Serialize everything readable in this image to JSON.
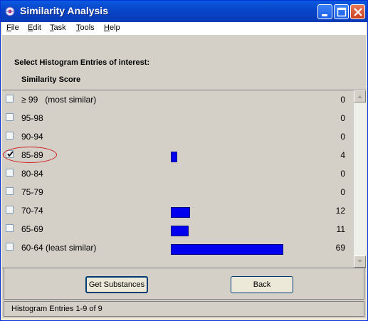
{
  "window": {
    "title": "Similarity Analysis",
    "icon": "app-icon",
    "controls": [
      "minimize-icon",
      "maximize-icon",
      "close-icon"
    ]
  },
  "menu": [
    {
      "label_first": "F",
      "label_rest": "ile"
    },
    {
      "label_first": "E",
      "label_rest": "dit"
    },
    {
      "label_first": "T",
      "label_rest": "ask"
    },
    {
      "label_first": "T",
      "label_rest": "ools"
    },
    {
      "label_first": "H",
      "label_rest": "elp"
    }
  ],
  "heading": "Select Histogram Entries of interest:",
  "column_header": "Similarity Score",
  "rows": [
    {
      "label": "≥ 99   (most similar)",
      "count": "0",
      "checked": false,
      "fraction": 0
    },
    {
      "label": "95-98",
      "count": "0",
      "checked": false,
      "fraction": 0
    },
    {
      "label": "90-94",
      "count": "0",
      "checked": false,
      "fraction": 0
    },
    {
      "label": "85-89",
      "count": "4",
      "checked": true,
      "fraction": 0.058
    },
    {
      "label": "80-84",
      "count": "0",
      "checked": false,
      "fraction": 0
    },
    {
      "label": "75-79",
      "count": "0",
      "checked": false,
      "fraction": 0
    },
    {
      "label": "70-74",
      "count": "12",
      "checked": false,
      "fraction": 0.174
    },
    {
      "label": "65-69",
      "count": "11",
      "checked": false,
      "fraction": 0.159
    },
    {
      "label": "60-64 (least similar)",
      "count": "69",
      "checked": false,
      "fraction": 1.0
    }
  ],
  "bar_color": "#0000ee",
  "buttons": {
    "get_substances": "Get Substances",
    "back": "Back"
  },
  "status": "Histogram Entries 1-9 of 9"
}
